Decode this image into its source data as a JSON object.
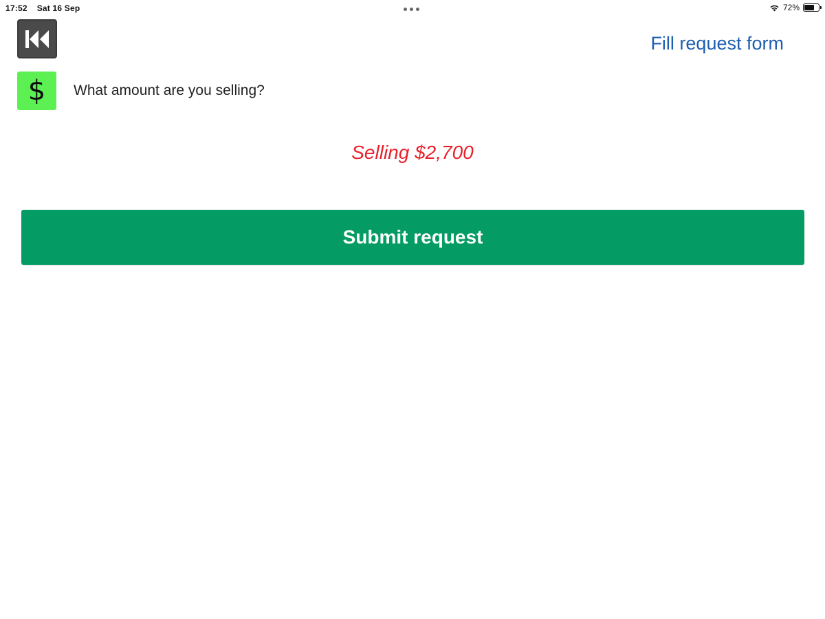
{
  "status_bar": {
    "time": "17:52",
    "date": "Sat 16 Sep",
    "battery_percent": "72%",
    "battery_level": 0.72
  },
  "header": {
    "back_icon": "rewind-icon",
    "title": "Fill request form"
  },
  "question": {
    "icon_glyph": "$",
    "icon_name": "dollar-icon",
    "label": "What amount are you selling?"
  },
  "selling_amount": "Selling $2,700",
  "submit": {
    "label": "Submit request"
  },
  "colors": {
    "title_blue": "#1f5fb0",
    "amount_red": "#e8212b",
    "submit_green": "#049c64",
    "dollar_tile_green": "#5cf053",
    "back_button_gray": "#4a4a4a"
  }
}
